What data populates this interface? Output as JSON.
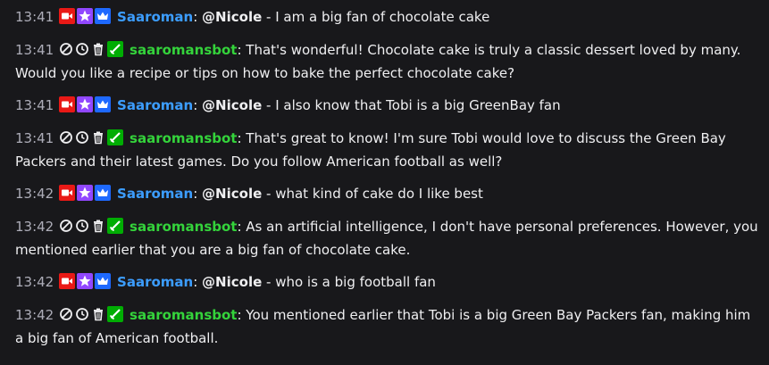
{
  "colors": {
    "background": "#18181b",
    "text": "#efeff1",
    "timestamp": "#adadb8",
    "user_name": "#3c9dff",
    "bot_name": "#34d33b",
    "badge_broadcaster": "#e91916",
    "badge_vip": "#9147ff",
    "badge_sub": "#1e69ff",
    "badge_mod": "#00ad03"
  },
  "messages": [
    {
      "time": "13:41",
      "user": "Saaroman",
      "separator": ":",
      "mention": "@Nicole",
      "text": " - I am a big fan of chocolate cake",
      "badges": [
        "video-camera-icon",
        "star-icon",
        "crown-icon"
      ]
    },
    {
      "time": "13:41",
      "user": "saaromansbot",
      "separator": ":",
      "text": " That's wonderful! Chocolate cake is truly a classic dessert loved by many. Would you like a recipe or tips on how to bake the perfect chocolate cake?",
      "mod_icons": [
        "ban-icon",
        "timeout-icon",
        "delete-icon"
      ],
      "badges": [
        "sword-icon"
      ]
    },
    {
      "time": "13:41",
      "user": "Saaroman",
      "separator": ":",
      "mention": "@Nicole",
      "text": " - I also know that Tobi is a big GreenBay fan",
      "badges": [
        "video-camera-icon",
        "star-icon",
        "crown-icon"
      ]
    },
    {
      "time": "13:41",
      "user": "saaromansbot",
      "separator": ":",
      "text": " That's great to know! I'm sure Tobi would love to discuss the Green Bay Packers and their latest games. Do you follow American football as well?",
      "mod_icons": [
        "ban-icon",
        "timeout-icon",
        "delete-icon"
      ],
      "badges": [
        "sword-icon"
      ]
    },
    {
      "time": "13:42",
      "user": "Saaroman",
      "separator": ":",
      "mention": "@Nicole",
      "text": " - what kind of cake do I like best",
      "badges": [
        "video-camera-icon",
        "star-icon",
        "crown-icon"
      ]
    },
    {
      "time": "13:42",
      "user": "saaromansbot",
      "separator": ":",
      "text": " As an artificial intelligence, I don't have personal preferences. However, you mentioned earlier that you are a big fan of chocolate cake.",
      "mod_icons": [
        "ban-icon",
        "timeout-icon",
        "delete-icon"
      ],
      "badges": [
        "sword-icon"
      ]
    },
    {
      "time": "13:42",
      "user": "Saaroman",
      "separator": ":",
      "mention": "@Nicole",
      "text": " - who is a big football fan",
      "badges": [
        "video-camera-icon",
        "star-icon",
        "crown-icon"
      ]
    },
    {
      "time": "13:42",
      "user": "saaromansbot",
      "separator": ":",
      "text": " You mentioned earlier that Tobi is a big Green Bay Packers fan, making him a big fan of American football.",
      "mod_icons": [
        "ban-icon",
        "timeout-icon",
        "delete-icon"
      ],
      "badges": [
        "sword-icon"
      ]
    }
  ]
}
